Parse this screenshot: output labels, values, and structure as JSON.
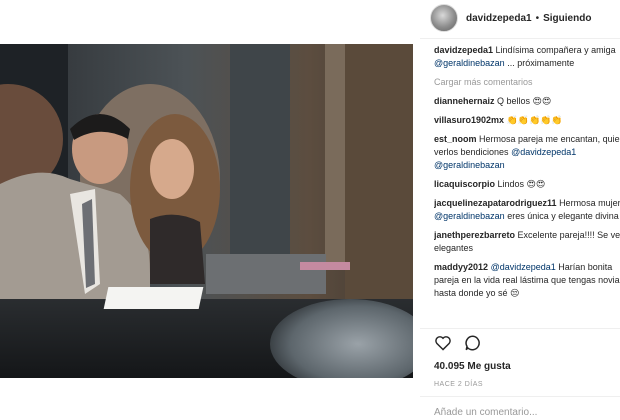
{
  "post": {
    "photo_alt_icon": "photo-of-couple",
    "header": {
      "username": "davidzepeda1",
      "separator": "•",
      "follow_status": "Siguiendo"
    },
    "caption": {
      "username": "davidzepeda1",
      "text_part1": "Lindísima compañera y amiga",
      "mention": "@geraldinebazan",
      "text_part2": "... próximamente"
    },
    "load_more_label": "Cargar más comentarios",
    "comments": [
      {
        "username": "diannehernaiz",
        "text": "Q bellos 😍😍"
      },
      {
        "username": "villasuro1902mx",
        "text": "👏👏👏👏👏"
      },
      {
        "username": "est_noom",
        "text": "Hermosa pareja me encantan, quiero verlos bendiciones",
        "mention1": "@davidzepeda1",
        "mention2": "@geraldinebazan"
      },
      {
        "username": "licaquiscorpio",
        "text": "Lindos 😍😍"
      },
      {
        "username": "jacquelinezapatarodriguez11",
        "text": "Hermosa mujer",
        "mention": "@geraldinebazan",
        "text2": "eres única y elegante divina"
      },
      {
        "username": "janethperezbarreto",
        "text": "Excelente pareja!!!! Se ven elegantes"
      },
      {
        "username": "maddyy2012",
        "mention": "@davidzepeda1",
        "text": "Harían bonita pareja en la vida real lástima que tengas novia hasta donde yo sé 😒"
      }
    ],
    "likes": "40.095 Me gusta",
    "time_ago": "HACE 2 DÍAS",
    "add_comment_placeholder": "Añade un comentario..."
  }
}
